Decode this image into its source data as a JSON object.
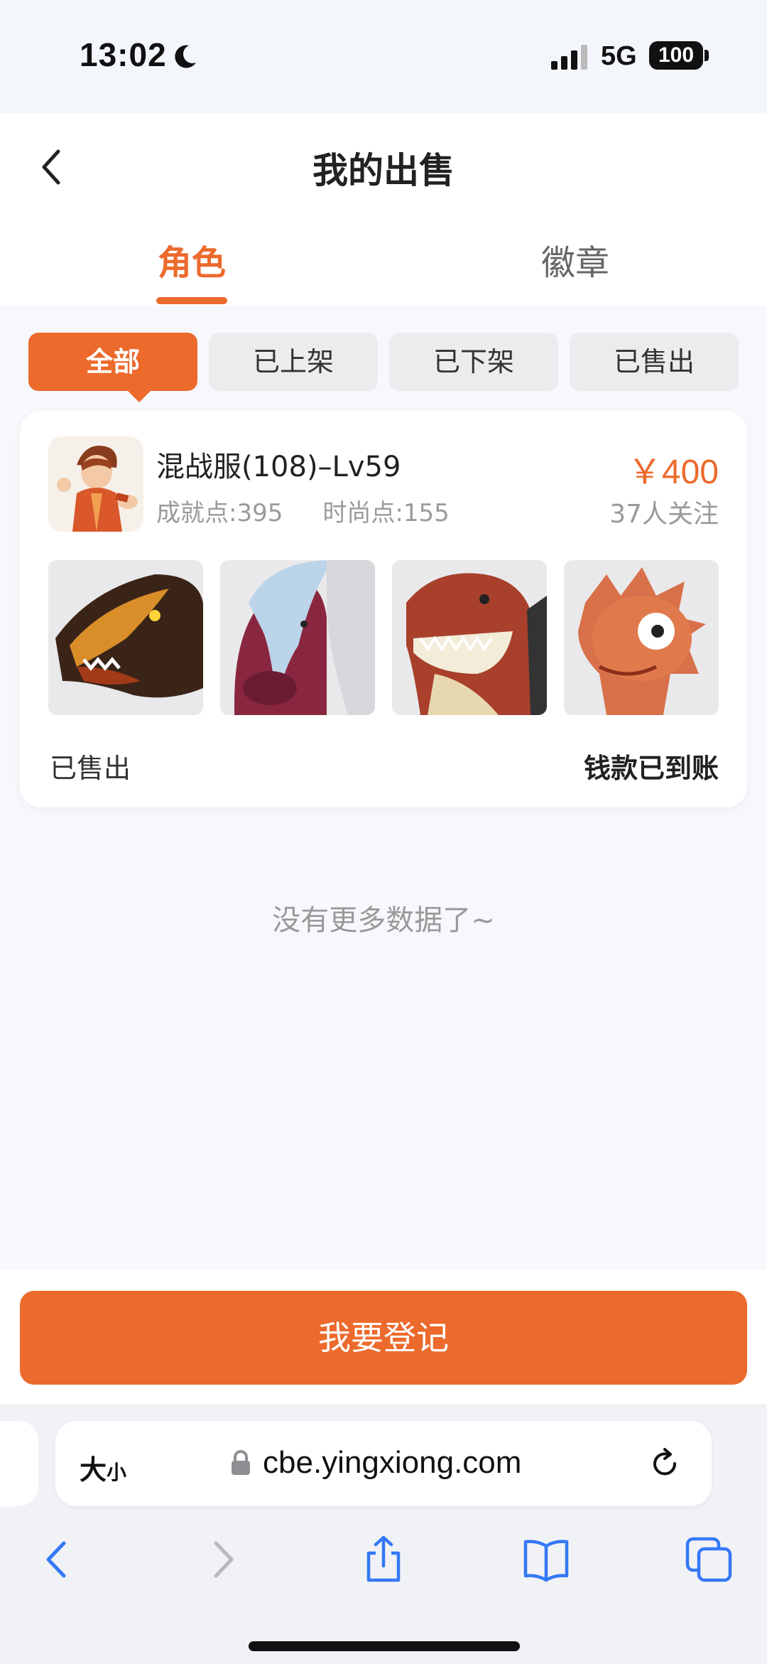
{
  "status_bar": {
    "time": "13:02",
    "network": "5G",
    "battery": "100"
  },
  "header": {
    "title": "我的出售"
  },
  "tabs": [
    {
      "label": "角色",
      "active": true
    },
    {
      "label": "徽章",
      "active": false
    }
  ],
  "filters": [
    {
      "label": "全部",
      "active": true
    },
    {
      "label": "已上架",
      "active": false
    },
    {
      "label": "已下架",
      "active": false
    },
    {
      "label": "已售出",
      "active": false
    }
  ],
  "listing": {
    "title": "混战服(108)–Lv59",
    "achievement": "成就点:395",
    "fashion": "时尚点:155",
    "price": "￥400",
    "followers": "37人关注",
    "status": "已售出",
    "payment_status": "钱款已到账",
    "thumbnails": [
      "dragon-pet",
      "horse-mount",
      "dinosaur-pet",
      "lizard-pet"
    ]
  },
  "footer_note": "没有更多数据了~",
  "register_button": "我要登记",
  "browser": {
    "text_size": "大",
    "text_size_small": "小",
    "url": "cbe.yingxiong.com"
  },
  "colors": {
    "accent": "#ec6a2c",
    "chip_bg": "#ececee",
    "page_bg": "#f6f8fc",
    "browser_blue": "#3478f6"
  }
}
